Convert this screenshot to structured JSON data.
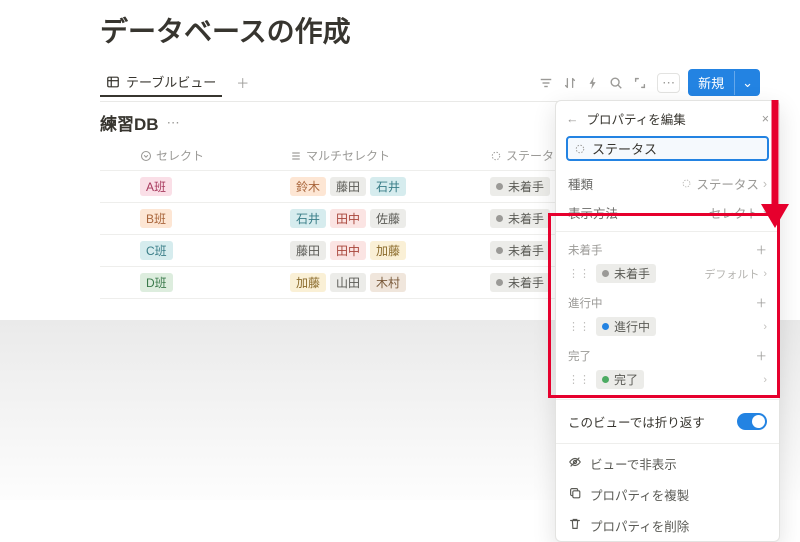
{
  "page_title": "データベースの作成",
  "view_tab": "テーブルビュー",
  "new_button": "新規",
  "db_name": "練習DB",
  "columns": {
    "select": "セレクト",
    "multi": "マルチセレクト",
    "status": "ステータス"
  },
  "rows": [
    {
      "select": {
        "label": "A班",
        "cls": "bg-pink"
      },
      "multi": [
        {
          "label": "鈴木",
          "cls": "bg-orange"
        },
        {
          "label": "藤田",
          "cls": "bg-gray"
        },
        {
          "label": "石井",
          "cls": "bg-teal"
        }
      ],
      "status": "未着手"
    },
    {
      "select": {
        "label": "B班",
        "cls": "bg-orange"
      },
      "multi": [
        {
          "label": "石井",
          "cls": "bg-teal"
        },
        {
          "label": "田中",
          "cls": "bg-pink2"
        },
        {
          "label": "佐藤",
          "cls": "bg-gray"
        }
      ],
      "status": "未着手"
    },
    {
      "select": {
        "label": "C班",
        "cls": "bg-teal"
      },
      "multi": [
        {
          "label": "藤田",
          "cls": "bg-gray"
        },
        {
          "label": "田中",
          "cls": "bg-pink2"
        },
        {
          "label": "加藤",
          "cls": "bg-yellow"
        }
      ],
      "status": "未着手"
    },
    {
      "select": {
        "label": "D班",
        "cls": "bg-green"
      },
      "multi": [
        {
          "label": "加藤",
          "cls": "bg-yellow"
        },
        {
          "label": "山田",
          "cls": "bg-gray"
        },
        {
          "label": "木村",
          "cls": "bg-brown"
        }
      ],
      "status": "未着手"
    }
  ],
  "panel": {
    "title": "プロパティを編集",
    "name_value": "ステータス",
    "type_label": "種類",
    "type_value": "ステータス",
    "display_label": "表示方法",
    "display_value": "セレクト",
    "groups": [
      {
        "label": "未着手",
        "option": "未着手",
        "dot": "",
        "suffix": "デフォルト"
      },
      {
        "label": "進行中",
        "option": "進行中",
        "dot": "blue",
        "suffix": ""
      },
      {
        "label": "完了",
        "option": "完了",
        "dot": "green",
        "suffix": ""
      }
    ],
    "fold_label": "このビューでは折り返す",
    "actions": {
      "hide": "ビューで非表示",
      "duplicate": "プロパティを複製",
      "delete": "プロパティを削除"
    }
  }
}
